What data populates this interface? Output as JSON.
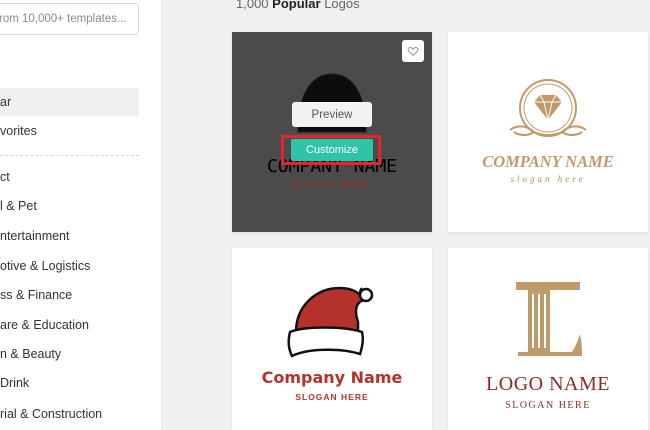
{
  "sidebar": {
    "search_placeholder": "rom 10,000+ templates...",
    "items": [
      {
        "label": "ar"
      },
      {
        "label": "vorites"
      },
      {
        "label": "ct"
      },
      {
        "label": "l & Pet"
      },
      {
        "label": "ntertainment"
      },
      {
        "label": "otive & Logistics"
      },
      {
        "label": "ss & Finance"
      },
      {
        "label": "are & Education"
      },
      {
        "label": "n & Beauty"
      },
      {
        "label": "Drink"
      },
      {
        "label": "rial & Construction"
      }
    ]
  },
  "heading": {
    "count": "1,000",
    "bold": "Popular",
    "suffix": "Logos"
  },
  "cards": [
    {
      "name": "COMPANY NAME",
      "slogan": "SLOGAN HERE",
      "preview_label": "Preview",
      "customize_label": "Customize",
      "favorite_icon": "heart-icon",
      "emblem_icon": "hooded-figure-icon"
    },
    {
      "name": "COMPANY NAME",
      "slogan": "slogan here",
      "emblem_icon": "diamond-crest-icon",
      "accent": "#c19a6b"
    },
    {
      "name": "Company Name",
      "slogan": "SLOGAN HERE",
      "emblem_icon": "santa-hat-icon",
      "accent": "#b5322a"
    },
    {
      "name": "LOGO NAME",
      "slogan": "SLOGAN HERE",
      "emblem_icon": "letter-l-column-icon",
      "accent": "#8c2a2a"
    }
  ],
  "colors": {
    "highlight": "#e8232f",
    "customize_button": "#2fc4a8",
    "overlay": "#3c3c3c"
  }
}
